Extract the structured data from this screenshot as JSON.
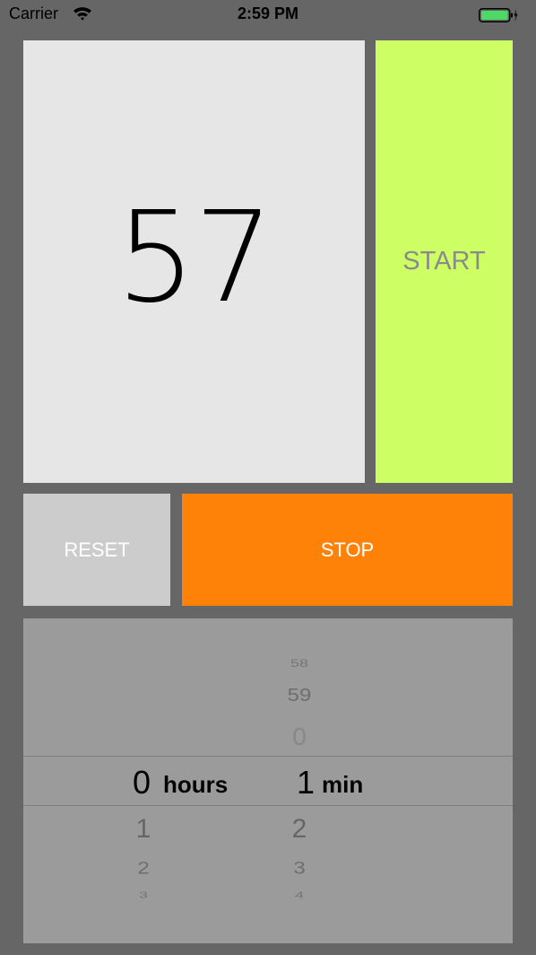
{
  "status_bar": {
    "carrier": "Carrier",
    "time": "2:59 PM",
    "wifi_icon": "wifi-icon",
    "battery_icon": "battery-icon",
    "battery_color": "#4cd964"
  },
  "timer": {
    "value": "57"
  },
  "buttons": {
    "start_label": "START",
    "reset_label": "RESET",
    "stop_label": "STOP"
  },
  "colors": {
    "background": "#666666",
    "display": "#e6e6e6",
    "start": "#cdfe63",
    "reset": "#cccccc",
    "stop": "#ff8208",
    "picker": "#9b9b9b"
  },
  "picker": {
    "hours": {
      "above": [
        "",
        "",
        ""
      ],
      "selected": "0",
      "unit": "hours",
      "below": [
        "1",
        "2",
        "3"
      ]
    },
    "minutes": {
      "above": [
        "58",
        "59",
        "0"
      ],
      "selected": "1",
      "unit": "min",
      "below": [
        "2",
        "3",
        "4"
      ]
    }
  }
}
